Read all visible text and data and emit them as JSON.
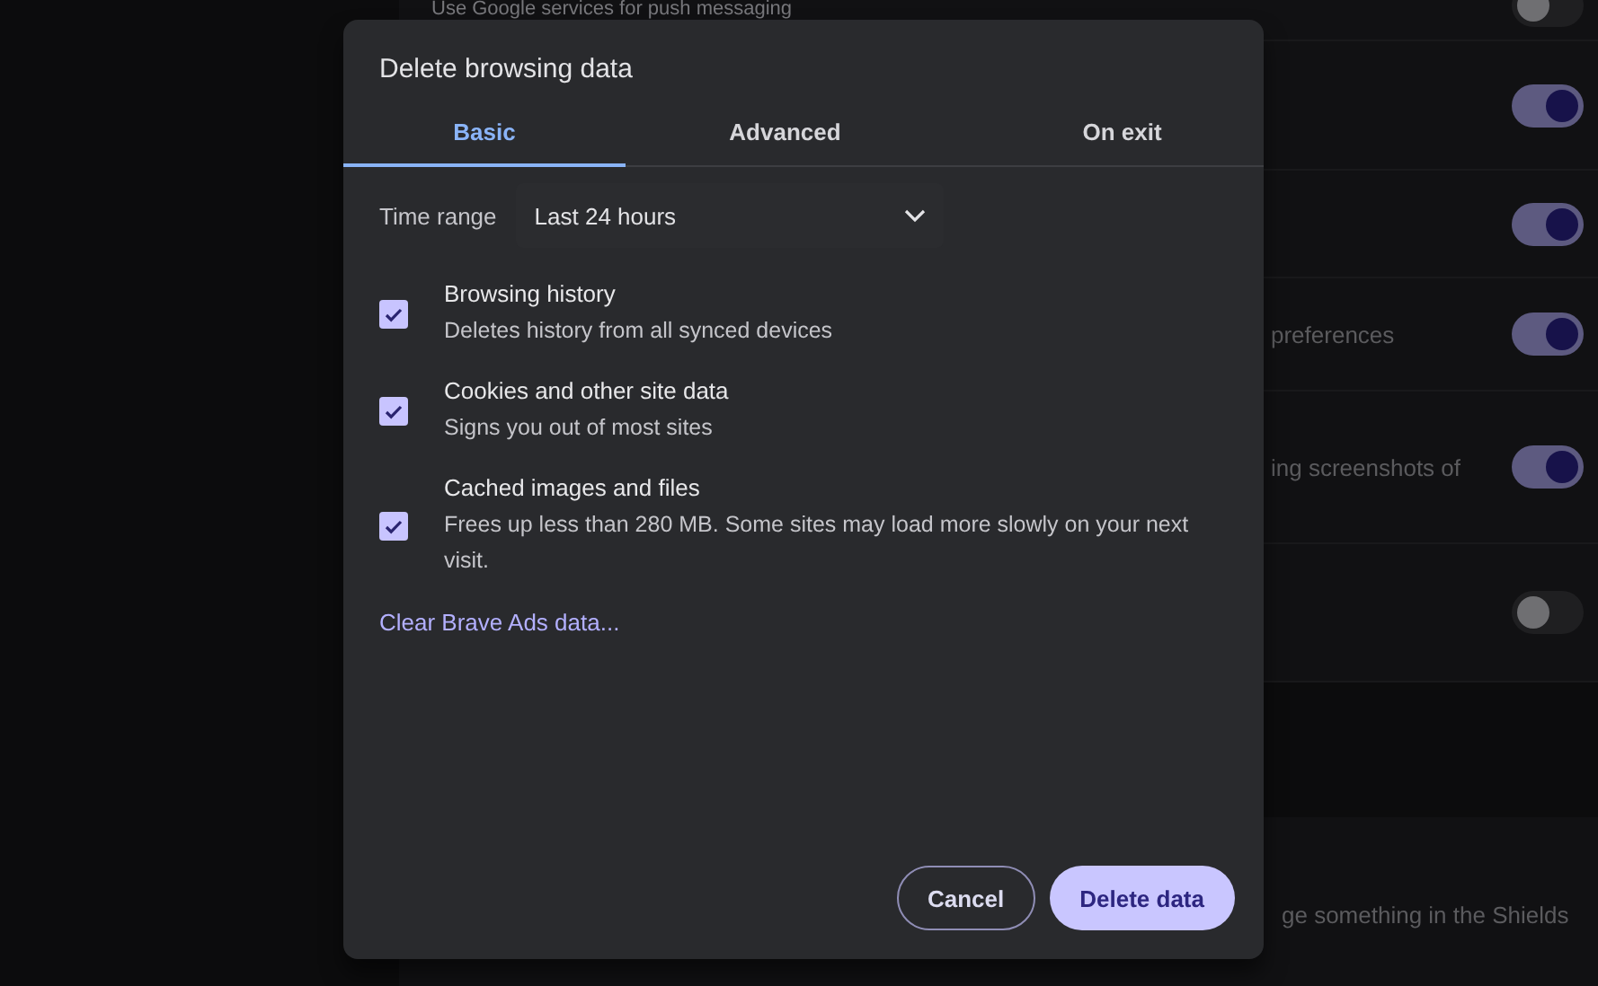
{
  "background": {
    "rows": [
      {
        "text": "Use Google services for push messaging",
        "on": false
      },
      {
        "on": true
      },
      {
        "on": true
      },
      {
        "text": "preferences",
        "on": true
      },
      {
        "text": "ing screenshots of",
        "on": true
      },
      {
        "on": false
      }
    ],
    "footer_text": "ge something in the Shields"
  },
  "dialog": {
    "title": "Delete browsing data",
    "tabs": [
      {
        "label": "Basic",
        "selected": true
      },
      {
        "label": "Advanced",
        "selected": false
      },
      {
        "label": "On exit",
        "selected": false
      }
    ],
    "time_range": {
      "label": "Time range",
      "value": "Last 24 hours"
    },
    "options": [
      {
        "title": "Browsing history",
        "description": "Deletes history from all synced devices",
        "checked": true
      },
      {
        "title": "Cookies and other site data",
        "description": "Signs you out of most sites",
        "checked": true
      },
      {
        "title": "Cached images and files",
        "description": "Frees up less than 280 MB. Some sites may load more slowly on your next visit.",
        "checked": true
      }
    ],
    "link": "Clear Brave Ads data...",
    "buttons": [
      {
        "label": "Cancel",
        "kind": "secondary"
      },
      {
        "label": "Delete data",
        "kind": "primary"
      }
    ]
  }
}
